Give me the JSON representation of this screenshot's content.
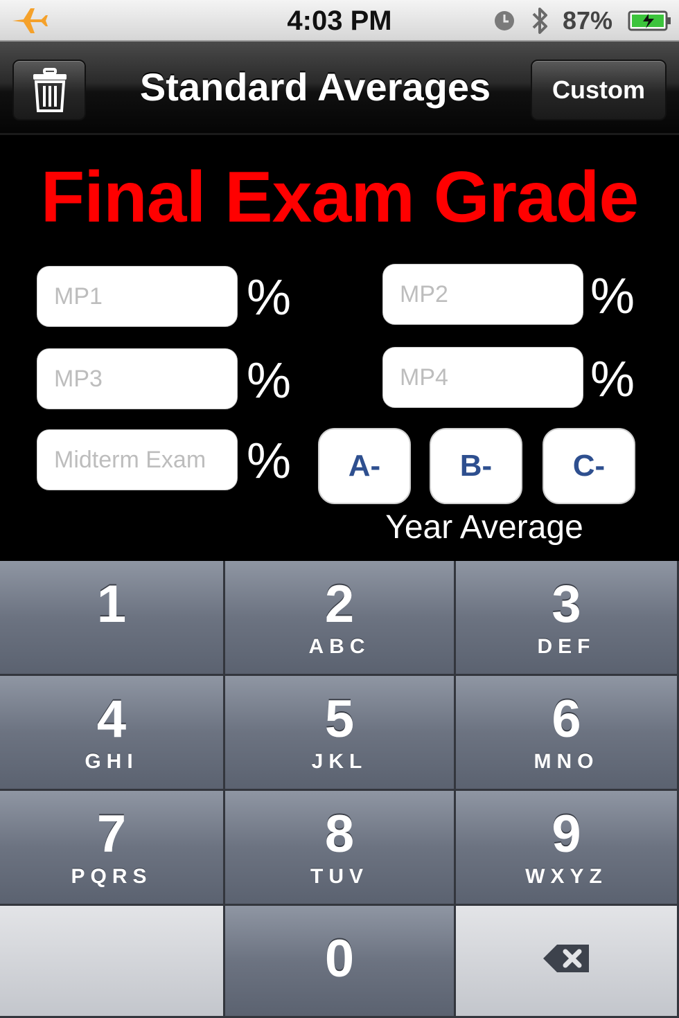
{
  "status_bar": {
    "time": "4:03 PM",
    "battery": "87%",
    "icons": [
      "airplane-icon",
      "clock-icon",
      "bluetooth-icon",
      "battery-icon"
    ]
  },
  "nav": {
    "title": "Standard Averages",
    "custom_label": "Custom",
    "trash_icon": "trash-icon"
  },
  "main": {
    "title": "Final Exam Grade",
    "fields": {
      "mp1": {
        "placeholder": "MP1",
        "value": ""
      },
      "mp2": {
        "placeholder": "MP2",
        "value": ""
      },
      "mp3": {
        "placeholder": "MP3",
        "value": ""
      },
      "mp4": {
        "placeholder": "MP4",
        "value": ""
      },
      "midterm": {
        "placeholder": "Midterm Exam",
        "value": ""
      }
    },
    "percent_symbol": "%",
    "grade_buttons": [
      "A-",
      "B-",
      "C-"
    ],
    "year_average_label": "Year Average"
  },
  "keypad": {
    "keys": [
      {
        "num": "1",
        "letters": ""
      },
      {
        "num": "2",
        "letters": "ABC"
      },
      {
        "num": "3",
        "letters": "DEF"
      },
      {
        "num": "4",
        "letters": "GHI"
      },
      {
        "num": "5",
        "letters": "JKL"
      },
      {
        "num": "6",
        "letters": "MNO"
      },
      {
        "num": "7",
        "letters": "PQRS"
      },
      {
        "num": "8",
        "letters": "TUV"
      },
      {
        "num": "9",
        "letters": "WXYZ"
      },
      {
        "num": "0",
        "letters": ""
      }
    ],
    "delete_icon": "backspace-icon"
  },
  "colors": {
    "title_red": "#ff0000",
    "grade_text_blue": "#2e4f8f",
    "airplane_orange": "#f5a12a",
    "battery_green": "#3cc43c"
  }
}
